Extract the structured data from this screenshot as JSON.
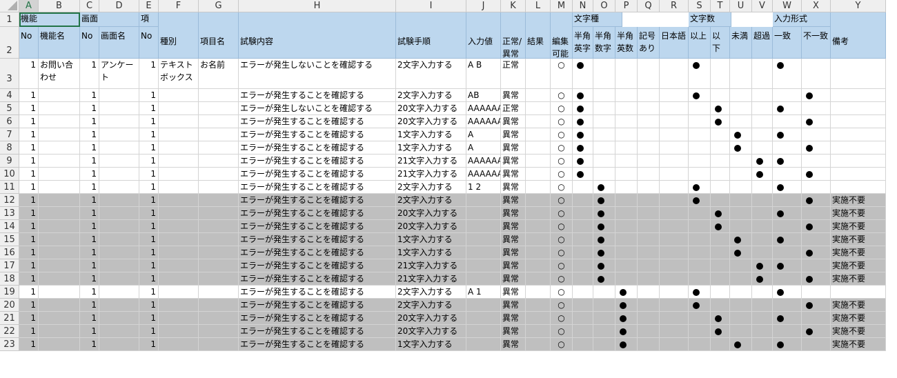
{
  "columns": [
    "A",
    "B",
    "C",
    "D",
    "E",
    "F",
    "G",
    "H",
    "I",
    "J",
    "K",
    "L",
    "M",
    "N",
    "O",
    "P",
    "Q",
    "R",
    "S",
    "T",
    "U",
    "V",
    "W",
    "X",
    "Y"
  ],
  "header_row1": {
    "A": "機能",
    "C": "画面",
    "E": "項",
    "N": "文字種",
    "S": "文字数",
    "W": "入力形式"
  },
  "header_row2": {
    "A": "No",
    "B": "機能名",
    "C": "No",
    "D": "画面名",
    "E": "No",
    "F": "種別",
    "G": "項目名",
    "H": "試験内容",
    "I": "試験手順",
    "J": "入力値",
    "K": "正常/\n異常",
    "L": "結果",
    "M": "編集\n可能",
    "N": "半角\n英字",
    "O": "半角\n数字",
    "P": "半角\n英数",
    "Q": "記号\nあり",
    "R": "日本語",
    "S": "以上",
    "T": "以下",
    "U": "未満",
    "V": "超過",
    "W": "一致",
    "X": "不一致",
    "Y": "備考"
  },
  "rows": [
    {
      "n": "3",
      "A": "1",
      "B": "お問い合わせ",
      "C": "1",
      "D": "アンケート",
      "E": "1",
      "F": "テキストボックス",
      "G": "お名前",
      "H": "エラーが発生しないことを確認する",
      "I": "2文字入力する",
      "J": "A B",
      "K": "正常",
      "M": "○",
      "dots": [
        "N",
        "S",
        "W"
      ],
      "grey": false
    },
    {
      "n": "4",
      "A": "1",
      "C": "1",
      "E": "1",
      "H": "エラーが発生することを確認する",
      "I": "2文字入力する",
      "J": "AB",
      "K": "異常",
      "M": "○",
      "dots": [
        "N",
        "S",
        "X"
      ],
      "grey": false
    },
    {
      "n": "5",
      "A": "1",
      "C": "1",
      "E": "1",
      "H": "エラーが発生しないことを確認する",
      "I": "20文字入力する",
      "J": "AAAAAA",
      "K": "正常",
      "M": "○",
      "dots": [
        "N",
        "T",
        "W"
      ],
      "grey": false
    },
    {
      "n": "6",
      "A": "1",
      "C": "1",
      "E": "1",
      "H": "エラーが発生することを確認する",
      "I": "20文字入力する",
      "J": "AAAAAA",
      "K": "異常",
      "M": "○",
      "dots": [
        "N",
        "T",
        "X"
      ],
      "grey": false
    },
    {
      "n": "7",
      "A": "1",
      "C": "1",
      "E": "1",
      "H": "エラーが発生することを確認する",
      "I": "1文字入力する",
      "J": "A",
      "K": "異常",
      "M": "○",
      "dots": [
        "N",
        "U",
        "W"
      ],
      "grey": false
    },
    {
      "n": "8",
      "A": "1",
      "C": "1",
      "E": "1",
      "H": "エラーが発生することを確認する",
      "I": "1文字入力する",
      "J": "A",
      "K": "異常",
      "M": "○",
      "dots": [
        "N",
        "U",
        "X"
      ],
      "grey": false
    },
    {
      "n": "9",
      "A": "1",
      "C": "1",
      "E": "1",
      "H": "エラーが発生することを確認する",
      "I": "21文字入力する",
      "J": "AAAAAA",
      "K": "異常",
      "M": "○",
      "dots": [
        "N",
        "V",
        "W"
      ],
      "grey": false
    },
    {
      "n": "10",
      "A": "1",
      "C": "1",
      "E": "1",
      "H": "エラーが発生することを確認する",
      "I": "21文字入力する",
      "J": "AAAAAA",
      "K": "異常",
      "M": "○",
      "dots": [
        "N",
        "V",
        "X"
      ],
      "grey": false
    },
    {
      "n": "11",
      "A": "1",
      "C": "1",
      "E": "1",
      "H": "エラーが発生することを確認する",
      "I": "2文字入力する",
      "J": "1 2",
      "K": "異常",
      "M": "○",
      "dots": [
        "O",
        "S",
        "W"
      ],
      "grey": false
    },
    {
      "n": "12",
      "A": "1",
      "C": "1",
      "E": "1",
      "H": "エラーが発生することを確認する",
      "I": "2文字入力する",
      "K": "異常",
      "M": "○",
      "dots": [
        "O",
        "S",
        "X"
      ],
      "Y": "実施不要",
      "grey": true
    },
    {
      "n": "13",
      "A": "1",
      "C": "1",
      "E": "1",
      "H": "エラーが発生することを確認する",
      "I": "20文字入力する",
      "K": "異常",
      "M": "○",
      "dots": [
        "O",
        "T",
        "W"
      ],
      "Y": "実施不要",
      "grey": true
    },
    {
      "n": "14",
      "A": "1",
      "C": "1",
      "E": "1",
      "H": "エラーが発生することを確認する",
      "I": "20文字入力する",
      "K": "異常",
      "M": "○",
      "dots": [
        "O",
        "T",
        "X"
      ],
      "Y": "実施不要",
      "grey": true
    },
    {
      "n": "15",
      "A": "1",
      "C": "1",
      "E": "1",
      "H": "エラーが発生することを確認する",
      "I": "1文字入力する",
      "K": "異常",
      "M": "○",
      "dots": [
        "O",
        "U",
        "W"
      ],
      "Y": "実施不要",
      "grey": true
    },
    {
      "n": "16",
      "A": "1",
      "C": "1",
      "E": "1",
      "H": "エラーが発生することを確認する",
      "I": "1文字入力する",
      "K": "異常",
      "M": "○",
      "dots": [
        "O",
        "U",
        "X"
      ],
      "Y": "実施不要",
      "grey": true
    },
    {
      "n": "17",
      "A": "1",
      "C": "1",
      "E": "1",
      "H": "エラーが発生することを確認する",
      "I": "21文字入力する",
      "K": "異常",
      "M": "○",
      "dots": [
        "O",
        "V",
        "W"
      ],
      "Y": "実施不要",
      "grey": true
    },
    {
      "n": "18",
      "A": "1",
      "C": "1",
      "E": "1",
      "H": "エラーが発生することを確認する",
      "I": "21文字入力する",
      "K": "異常",
      "M": "○",
      "dots": [
        "O",
        "V",
        "X"
      ],
      "Y": "実施不要",
      "grey": true
    },
    {
      "n": "19",
      "A": "1",
      "C": "1",
      "E": "1",
      "H": "エラーが発生することを確認する",
      "I": "2文字入力する",
      "J": "A 1",
      "K": "異常",
      "M": "○",
      "dots": [
        "P",
        "S",
        "W"
      ],
      "grey": false
    },
    {
      "n": "20",
      "A": "1",
      "C": "1",
      "E": "1",
      "H": "エラーが発生することを確認する",
      "I": "2文字入力する",
      "K": "異常",
      "M": "○",
      "dots": [
        "P",
        "S",
        "X"
      ],
      "Y": "実施不要",
      "grey": true
    },
    {
      "n": "21",
      "A": "1",
      "C": "1",
      "E": "1",
      "H": "エラーが発生することを確認する",
      "I": "20文字入力する",
      "K": "異常",
      "M": "○",
      "dots": [
        "P",
        "T",
        "W"
      ],
      "Y": "実施不要",
      "grey": true
    },
    {
      "n": "22",
      "A": "1",
      "C": "1",
      "E": "1",
      "H": "エラーが発生することを確認する",
      "I": "20文字入力する",
      "K": "異常",
      "M": "○",
      "dots": [
        "P",
        "T",
        "X"
      ],
      "Y": "実施不要",
      "grey": true
    },
    {
      "n": "23",
      "A": "1",
      "C": "1",
      "E": "1",
      "H": "エラーが発生することを確認する",
      "I": "1文字入力する",
      "K": "異常",
      "M": "○",
      "dots": [
        "P",
        "U",
        "W"
      ],
      "Y": "実施不要",
      "grey": true
    }
  ],
  "colors": {
    "header_fill": "#bdd7ee",
    "grey_fill": "#bfbfbf",
    "selection": "#217346"
  }
}
